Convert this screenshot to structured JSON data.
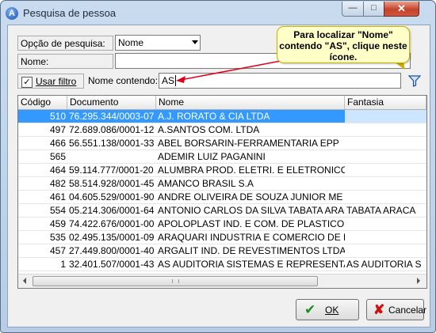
{
  "window": {
    "title": "Pesquisa de pessoa"
  },
  "form": {
    "search_option_label": "Opção de pesquisa:",
    "search_option_value": "Nome",
    "name_label": "Nome:",
    "name_value": "",
    "use_filter_label": "Usar filtro",
    "use_filter_checked": true,
    "name_contains_label": "Nome contendo:",
    "name_contains_value": "AS"
  },
  "tooltip": {
    "text": "Para localizar \"Nome\" contendo \"AS\", clique neste ícone."
  },
  "grid": {
    "columns": [
      "Código",
      "Documento",
      "Nome",
      "Fantasia"
    ],
    "selected_index": 0,
    "rows": [
      {
        "code": "510",
        "doc": "76.295.344/0003-07",
        "name": "A.J. RORATO & CIA LTDA",
        "fant": ""
      },
      {
        "code": "497",
        "doc": "72.689.086/0001-12",
        "name": "A.SANTOS COM. LTDA",
        "fant": ""
      },
      {
        "code": "466",
        "doc": "56.551.138/0001-33",
        "name": "ABEL BORSARIN-FERRAMENTARIA EPP",
        "fant": ""
      },
      {
        "code": "565",
        "doc": "",
        "name": "ADEMIR LUIZ PAGANINI",
        "fant": ""
      },
      {
        "code": "464",
        "doc": "59.114.777/0001-20",
        "name": "ALUMBRA PROD. ELETRI. E ELETRONICOS LT",
        "fant": ""
      },
      {
        "code": "482",
        "doc": "58.514.928/0001-45",
        "name": "AMANCO BRASIL S.A",
        "fant": ""
      },
      {
        "code": "461",
        "doc": "04.605.529/0001-90",
        "name": "ANDRE OLIVEIRA DE SOUZA JUNIOR ME",
        "fant": ""
      },
      {
        "code": "554",
        "doc": "05.214.306/0001-64",
        "name": "ANTONIO CARLOS DA SILVA TABATA ARACAT",
        "fant": "TABATA ARACA"
      },
      {
        "code": "459",
        "doc": "74.422.676/0001-00",
        "name": "APOLOPLAST IND. E COM. DE PLASTICO LTDA",
        "fant": ""
      },
      {
        "code": "535",
        "doc": "02.495.135/0001-09",
        "name": "ARAQUARI INDUSTRIA E COMERCIO DE FIBRA",
        "fant": ""
      },
      {
        "code": "457",
        "doc": "27.449.800/0001-40",
        "name": "ARGALIT IND. DE REVESTIMENTOS LTDA",
        "fant": ""
      },
      {
        "code": "1",
        "doc": "32.401.507/0001-43",
        "name": "AS AUDITORIA SISTEMAS E REPRESENTAÇÕ",
        "fant": "AS AUDITORIA S"
      }
    ]
  },
  "buttons": {
    "ok_label": "OK",
    "cancel_label": "Cancelar"
  },
  "colors": {
    "selection": "#3399ff",
    "tooltip_bg": "#ffffc8",
    "arrow": "#e0001a"
  }
}
